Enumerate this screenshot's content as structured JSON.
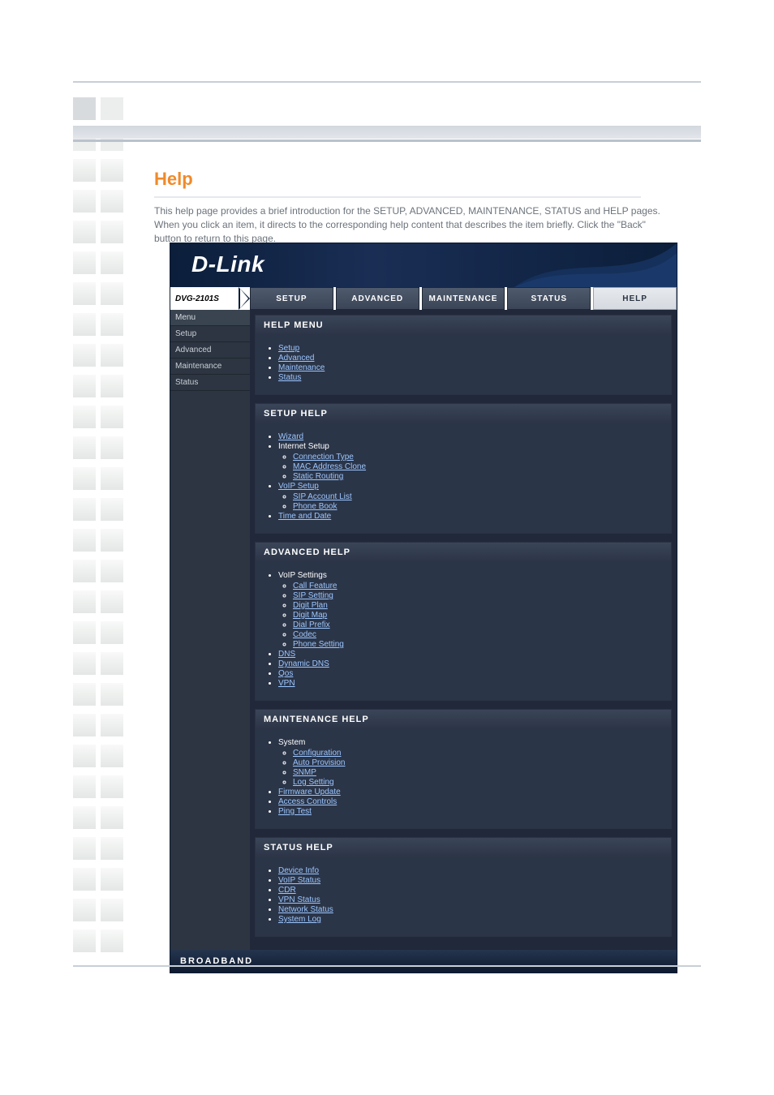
{
  "doc": {
    "title_line": "",
    "help_heading": "Help",
    "help_intro": "This help page provides a brief introduction for the SETUP, ADVANCED, MAINTENANCE, STATUS and HELP pages. When you click an item, it directs to the corresponding help content that describes the item briefly. Click the \"Back\" button to return to this page."
  },
  "router": {
    "brand": "D-Link",
    "model": "DVG-2101S",
    "tabs": [
      "SETUP",
      "ADVANCED",
      "MAINTENANCE",
      "STATUS",
      "HELP"
    ],
    "active_tab": 4,
    "left_menu": {
      "head": "Menu",
      "items": [
        "Setup",
        "Advanced",
        "Maintenance",
        "Status"
      ]
    },
    "panels": {
      "help_menu": {
        "title": "HELP MENU",
        "items": [
          {
            "label": "Setup",
            "link": true
          },
          {
            "label": "Advanced",
            "link": true
          },
          {
            "label": "Maintenance",
            "link": true
          },
          {
            "label": "Status",
            "link": true
          }
        ]
      },
      "setup_help": {
        "title": "SETUP HELP",
        "items": [
          {
            "label": "Wizard",
            "link": true
          },
          {
            "label": "Internet Setup",
            "link": false,
            "children": [
              {
                "label": "Connection Type",
                "link": true
              },
              {
                "label": "MAC Address Clone",
                "link": true
              },
              {
                "label": "Static Routing",
                "link": true
              }
            ]
          },
          {
            "label": "VoIP Setup",
            "link": true,
            "children": [
              {
                "label": "SIP Account List",
                "link": true
              },
              {
                "label": "Phone Book",
                "link": true
              }
            ]
          },
          {
            "label": "Time and Date",
            "link": true
          }
        ]
      },
      "advanced_help": {
        "title": "ADVANCED HELP",
        "items": [
          {
            "label": "VoIP Settings",
            "link": false,
            "children": [
              {
                "label": "Call Feature",
                "link": true
              },
              {
                "label": "SIP Setting",
                "link": true
              },
              {
                "label": "Digit Plan",
                "link": true
              },
              {
                "label": "Digit Map",
                "link": true
              },
              {
                "label": "Dial Prefix",
                "link": true
              },
              {
                "label": "Codec",
                "link": true
              },
              {
                "label": "Phone Setting",
                "link": true
              }
            ]
          },
          {
            "label": "DNS",
            "link": true
          },
          {
            "label": "Dynamic DNS",
            "link": true
          },
          {
            "label": "Qos",
            "link": true
          },
          {
            "label": "VPN",
            "link": true
          }
        ]
      },
      "maintenance_help": {
        "title": "MAINTENANCE HELP",
        "items": [
          {
            "label": "System",
            "link": false,
            "children": [
              {
                "label": "Configuration",
                "link": true
              },
              {
                "label": "Auto Provision",
                "link": true
              },
              {
                "label": "SNMP",
                "link": true
              },
              {
                "label": "Log Setting",
                "link": true
              }
            ]
          },
          {
            "label": "Firmware Update",
            "link": true
          },
          {
            "label": "Access Controls",
            "link": true
          },
          {
            "label": "Ping Test",
            "link": true
          }
        ]
      },
      "status_help": {
        "title": "STATUS HELP",
        "items": [
          {
            "label": "Device Info",
            "link": true
          },
          {
            "label": "VoIP Status",
            "link": true
          },
          {
            "label": "CDR",
            "link": true
          },
          {
            "label": "VPN Status",
            "link": true
          },
          {
            "label": "Network Status",
            "link": true
          },
          {
            "label": "System Log",
            "link": true
          }
        ]
      }
    },
    "footer": "BROADBAND"
  },
  "page_footer": {
    "left": "",
    "right": ""
  }
}
